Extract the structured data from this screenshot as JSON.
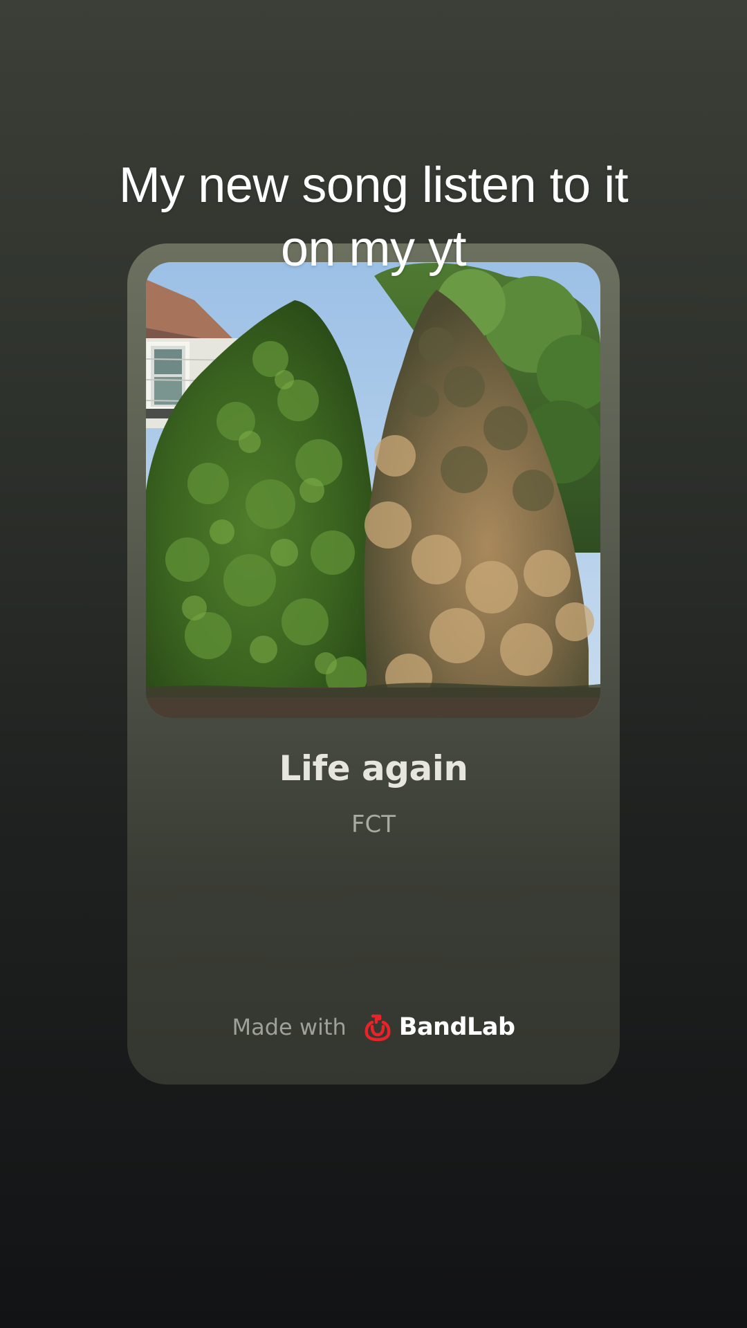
{
  "caption": {
    "line1": "My new song listen to it",
    "line2": "on my yt"
  },
  "card": {
    "song_title": "Life again",
    "artist": "FCT"
  },
  "footer": {
    "made_with": "Made with",
    "brand_name": "BandLab",
    "brand_icon": "bandlab-logo-icon",
    "brand_color": "#e8232a"
  },
  "colors": {
    "background_top": "#3b3f37",
    "background_bottom": "#121315"
  }
}
